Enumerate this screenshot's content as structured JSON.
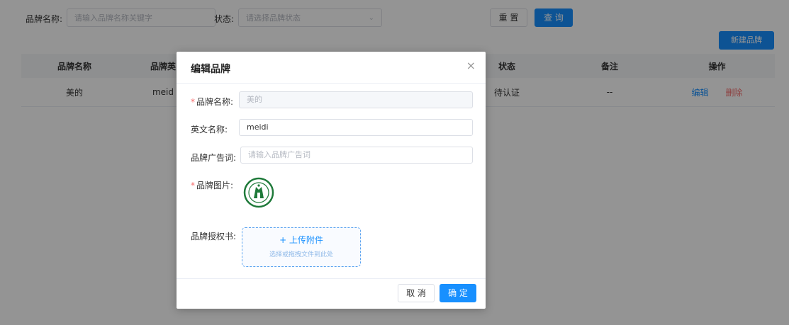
{
  "filter": {
    "brand_name_label": "品牌名称:",
    "brand_name_placeholder": "请输入品牌名称关键字",
    "status_label": "状态:",
    "status_placeholder": "请选择品牌状态",
    "reset_label": "重 置",
    "query_label": "查 询",
    "new_brand_label": "新建品牌"
  },
  "table": {
    "columns": [
      "品牌名称",
      "品牌英",
      "状态",
      "备注",
      "操作"
    ],
    "rows": [
      {
        "name": "美的",
        "english": "meid",
        "status": "待认证",
        "remark": "--",
        "edit": "编辑",
        "delete": "删除"
      }
    ]
  },
  "modal": {
    "title": "编辑品牌",
    "close_icon": "×",
    "fields": {
      "brand_name": {
        "label": "品牌名称:",
        "value": "美的"
      },
      "english_name": {
        "label": "英文名称:",
        "value": "meidi"
      },
      "slogan": {
        "label": "品牌广告词:",
        "placeholder": "请输入品牌广告词"
      },
      "brand_image": {
        "label": "品牌图片:"
      },
      "auth": {
        "label": "品牌授权书:",
        "upload_title": "+ 上传附件",
        "upload_hint": "选择或拖拽文件到此处"
      }
    },
    "cancel_label": "取 消",
    "confirm_label": "确 定"
  },
  "colors": {
    "primary": "#1890ff",
    "danger": "#f56c6c"
  }
}
